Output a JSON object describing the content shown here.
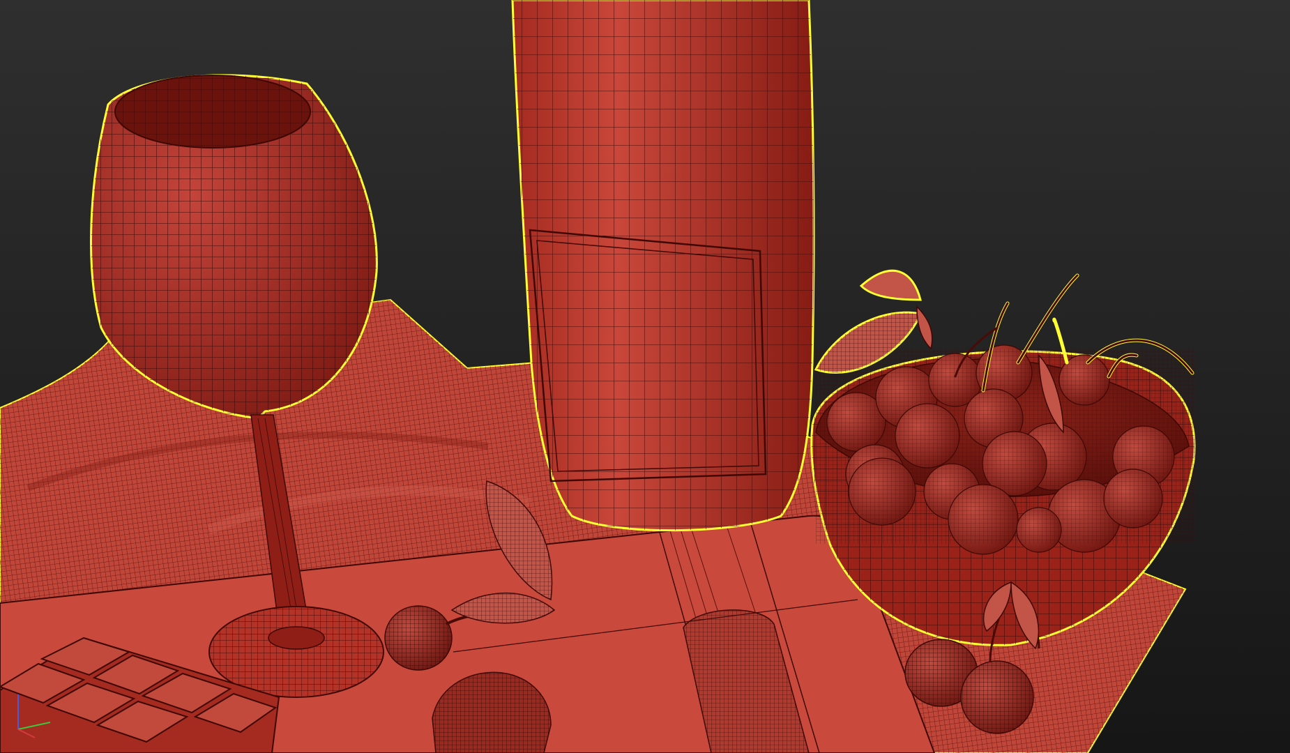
{
  "viewport": {
    "background_top": "#2f2f2f",
    "background_bottom": "#161616",
    "selection_outline": "#ffff33",
    "wire_color": "#4a0a06",
    "mesh_fill": "#b33328",
    "mesh_fill_light": "#c9493b",
    "mesh_fill_dark": "#6e140e"
  },
  "scene_objects": [
    {
      "id": "wine-glass",
      "selected": true
    },
    {
      "id": "wine-bottle",
      "selected": true
    },
    {
      "id": "cherry-bowl",
      "selected": true
    },
    {
      "id": "tablecloth",
      "selected": true
    },
    {
      "id": "cutting-board",
      "selected": false
    },
    {
      "id": "chocolate-bar",
      "selected": false
    },
    {
      "id": "truffle",
      "selected": false
    },
    {
      "id": "loose-cherries",
      "selected": false
    }
  ],
  "axis_gizmo": {
    "x_color": "#d23c3c",
    "y_color": "#3cc83c",
    "z_color": "#4a5ad8"
  }
}
